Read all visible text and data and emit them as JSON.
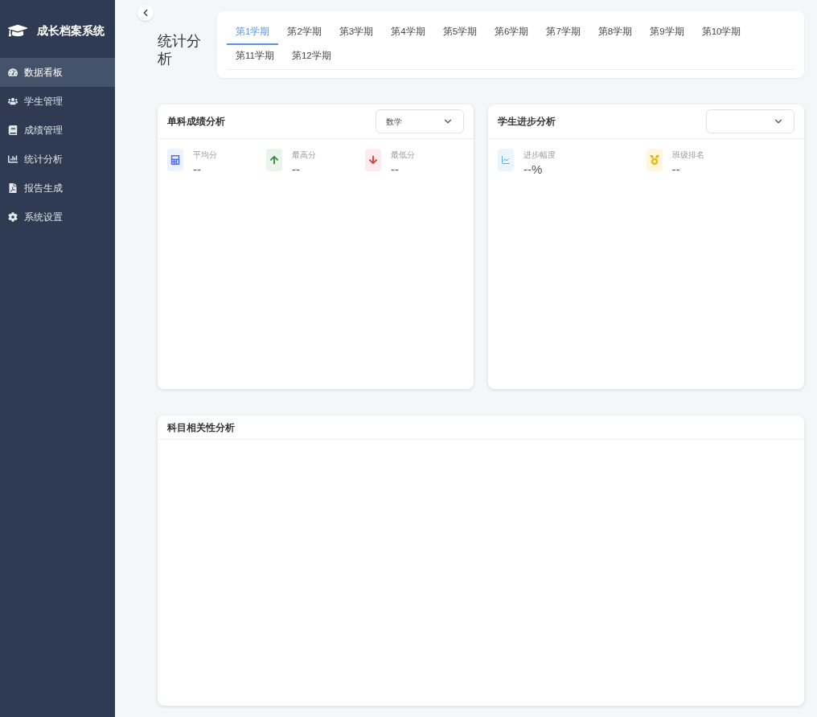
{
  "sidebar": {
    "brand": "成长档案系统",
    "items": [
      {
        "label": "数据看板",
        "selected": true
      },
      {
        "label": "学生管理",
        "selected": false
      },
      {
        "label": "成绩管理",
        "selected": false
      },
      {
        "label": "统计分析",
        "selected": false
      },
      {
        "label": "报告生成",
        "selected": false
      },
      {
        "label": "系统设置",
        "selected": false
      }
    ]
  },
  "page_title": "统计分析",
  "tabs": [
    {
      "label": "第1学期",
      "selected": true
    },
    {
      "label": "第2学期",
      "selected": false
    },
    {
      "label": "第3学期",
      "selected": false
    },
    {
      "label": "第4学期",
      "selected": false
    },
    {
      "label": "第5学期",
      "selected": false
    },
    {
      "label": "第6学期",
      "selected": false
    },
    {
      "label": "第7学期",
      "selected": false
    },
    {
      "label": "第8学期",
      "selected": false
    },
    {
      "label": "第9学期",
      "selected": false
    },
    {
      "label": "第10学期",
      "selected": false
    },
    {
      "label": "第11学期",
      "selected": false
    },
    {
      "label": "第12学期",
      "selected": false
    }
  ],
  "cards": [
    {
      "title": "单科成绩分析",
      "select": {
        "value": "数学"
      },
      "stats": [
        {
          "kind": "calculator",
          "label": "平均分",
          "value": "--"
        },
        {
          "kind": "up",
          "label": "最高分",
          "value": "--"
        },
        {
          "kind": "down",
          "label": "最低分",
          "value": "--"
        }
      ]
    },
    {
      "title": "学生进步分析",
      "stats": [
        {
          "kind": "trend",
          "label": "进步幅度",
          "value": "--%"
        },
        {
          "kind": "medal",
          "label": "班级排名",
          "value": "--"
        }
      ]
    }
  ],
  "correlation": {
    "title": "科目相关性分析"
  }
}
